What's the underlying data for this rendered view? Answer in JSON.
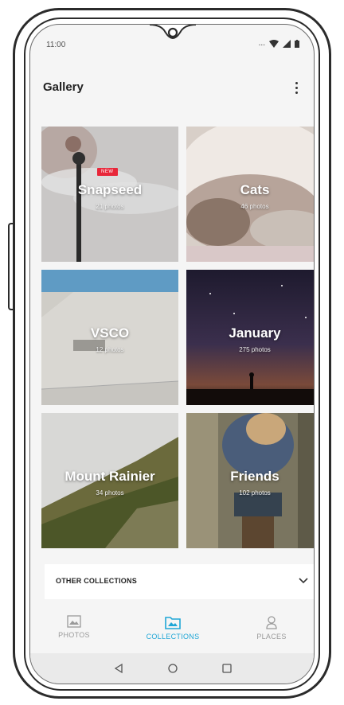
{
  "status_bar": {
    "time": "11:00",
    "signal_text": "..."
  },
  "app_bar": {
    "title": "Gallery"
  },
  "collections": [
    {
      "name": "Snapseed",
      "count": "21 photos",
      "badge": "NEW"
    },
    {
      "name": "Cats",
      "count": "46 photos"
    },
    {
      "name": "VSCO",
      "count": "12 photos"
    },
    {
      "name": "January",
      "count": "275 photos"
    },
    {
      "name": "Mount Rainier",
      "count": "34 photos"
    },
    {
      "name": "Friends",
      "count": "102 photos"
    }
  ],
  "other_collections": {
    "label": "OTHER COLLECTIONS"
  },
  "bottom_nav": {
    "items": [
      {
        "label": "PHOTOS",
        "icon": "image-icon"
      },
      {
        "label": "COLLECTIONS",
        "icon": "folder-image-icon",
        "active": true
      },
      {
        "label": "PLACES",
        "icon": "place-icon"
      }
    ]
  },
  "colors": {
    "accent": "#1ea6d6",
    "badge": "#e8273a"
  }
}
